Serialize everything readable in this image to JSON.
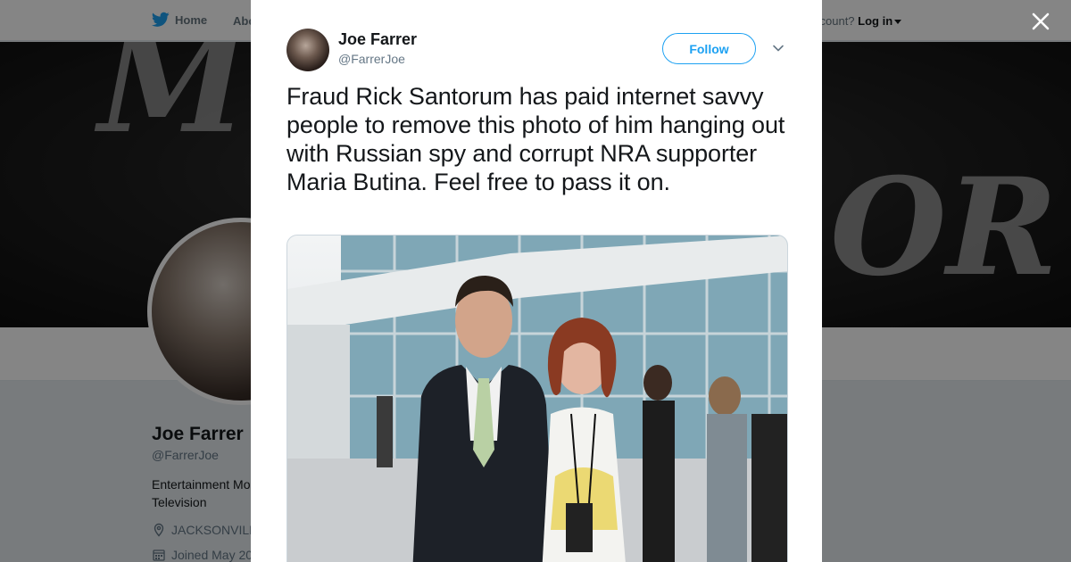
{
  "nav": {
    "home_label": "Home",
    "about_label": "Abo",
    "login_prefix": "ccount?",
    "login_label": "Log in"
  },
  "banner": {
    "text_left": "MO",
    "text_right": "OR"
  },
  "profile": {
    "name": "Joe Farrer",
    "handle": "@FarrerJoe",
    "bio": "Entertainment Mo Television",
    "location": "JACKSONVILL",
    "joined": "Joined May 20"
  },
  "tweet": {
    "author_name": "Joe Farrer",
    "author_handle": "@FarrerJoe",
    "follow_label": "Follow",
    "text": "Fraud Rick Santorum has paid internet savvy people to remove this photo of him hanging out with Russian spy and corrupt NRA supporter Maria Butina. Feel free to pass it on."
  },
  "colors": {
    "brand_blue": "#1da1f2",
    "text_primary": "#14171a",
    "text_secondary": "#657786"
  },
  "icons": {
    "twitter": "twitter-bird-icon",
    "close": "close-icon",
    "chevron": "chevron-down-icon",
    "location": "location-pin-icon",
    "calendar": "calendar-icon"
  }
}
